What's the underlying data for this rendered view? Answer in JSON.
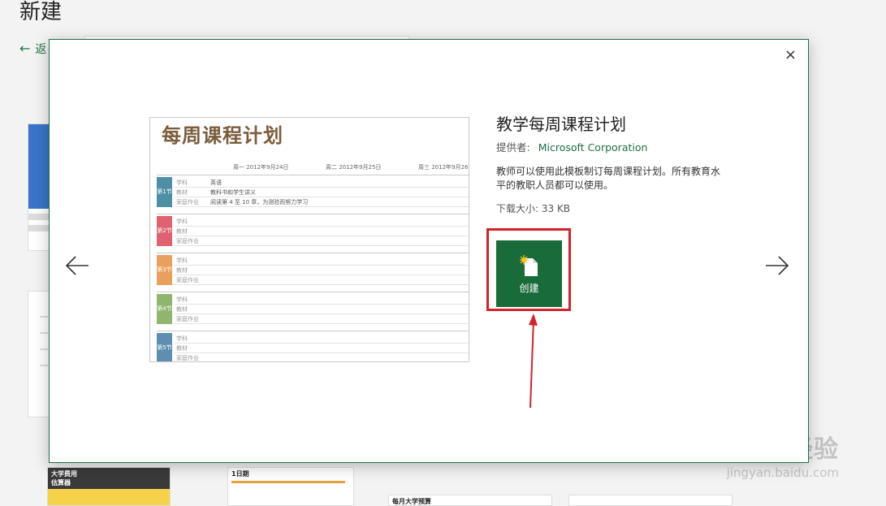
{
  "page": {
    "title": "新建",
    "back_label": "返"
  },
  "modal": {
    "close_glyph": "×",
    "template_title": "教学每周课程计划",
    "provider_label": "提供者:",
    "provider_name": "Microsoft Corporation",
    "description": "教师可以使用此模板制订每周课程计划。所有教育水平的教职人员都可以使用。",
    "download_size": "下载大小:  33 KB",
    "create_label": "创建",
    "icons": {
      "prev": "arrow-left-icon",
      "next": "arrow-right-icon",
      "create": "new-document-icon"
    }
  },
  "preview": {
    "title": "每周课程计划",
    "days": [
      "周一 2012年9月24日",
      "周二 2012年9月25日",
      "周三 2012年9月26日"
    ],
    "blocks": [
      {
        "tag": "第1节",
        "color": "#4f8fa6",
        "subject_label": "学科",
        "subject": "英语",
        "material_label": "教材",
        "material": "教科书和学生讲义",
        "homework_label": "家庭作业",
        "homework": "阅读第 4 至 10 章，为测验而努力学习"
      },
      {
        "tag": "第2节",
        "color": "#e06270",
        "subject_label": "学科",
        "subject": "",
        "material_label": "教材",
        "material": "",
        "homework_label": "家庭作业",
        "homework": ""
      },
      {
        "tag": "第3节",
        "color": "#e8a05c",
        "subject_label": "学科",
        "subject": "",
        "material_label": "教材",
        "material": "",
        "homework_label": "家庭作业",
        "homework": ""
      },
      {
        "tag": "第4节",
        "color": "#8fb56e",
        "subject_label": "学科",
        "subject": "",
        "material_label": "教材",
        "material": "",
        "homework_label": "家庭作业",
        "homework": ""
      },
      {
        "tag": "第5节",
        "color": "#5f8fb0",
        "subject_label": "学科",
        "subject": "",
        "material_label": "教材",
        "material": "",
        "homework_label": "家庭作业",
        "homework": ""
      }
    ]
  },
  "bottom": {
    "card1_label": "大学费用\n估算器",
    "card2_label": "1日期",
    "card3_label": "每月大学预算"
  },
  "watermark": {
    "line1": "Bai du 经验",
    "line2": "jingyan.baidu.com"
  },
  "colors": {
    "accent": "#1e6f43",
    "create_bg": "#1a6b3a",
    "highlight": "#d2232a"
  }
}
